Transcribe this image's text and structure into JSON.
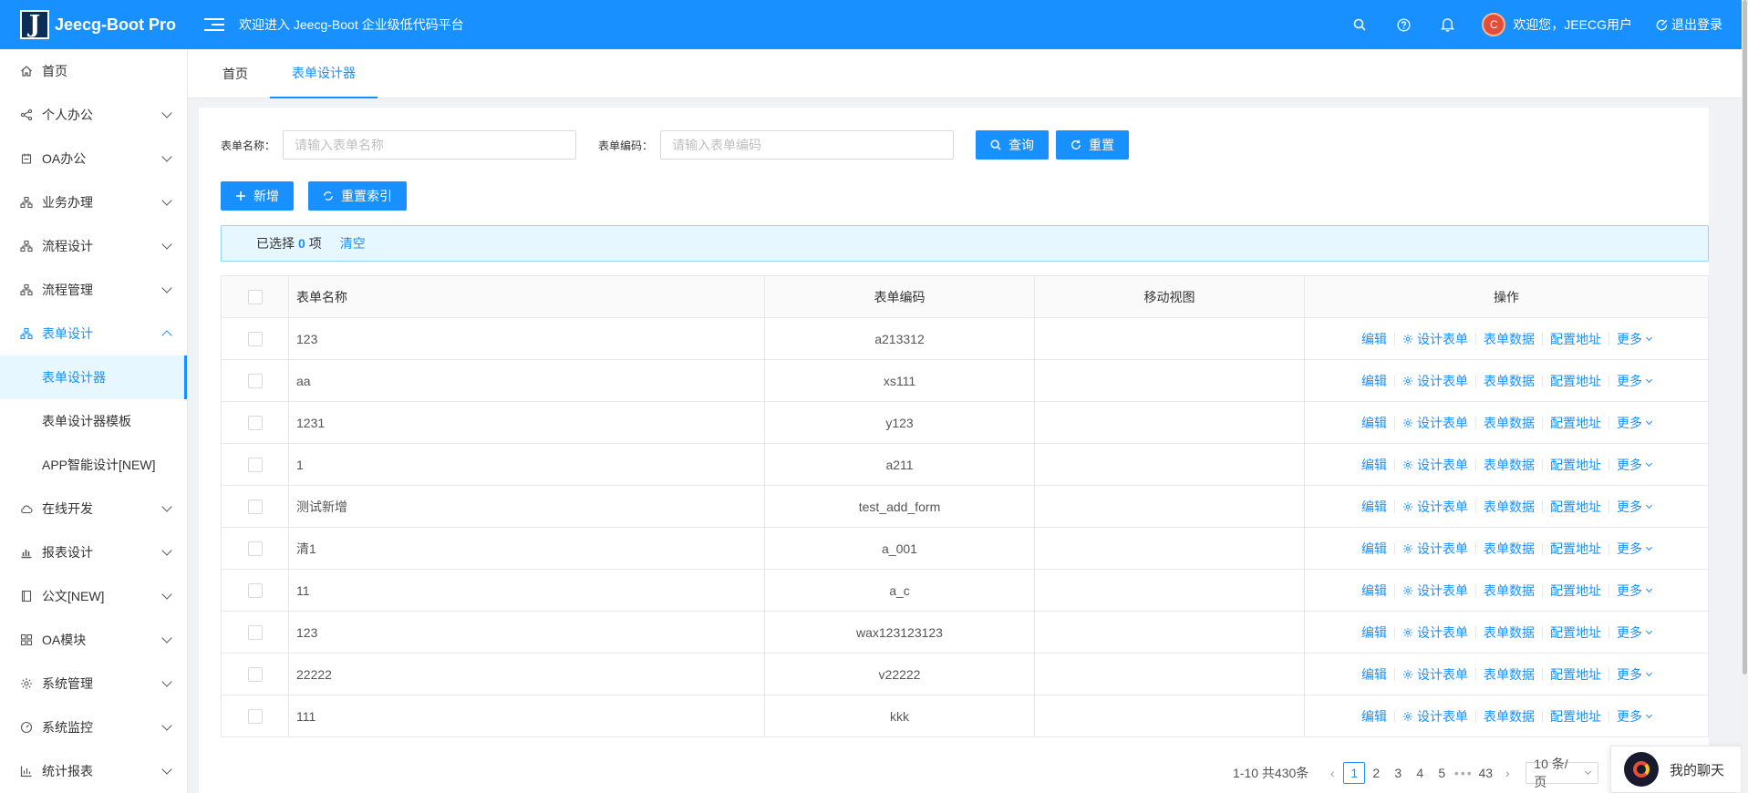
{
  "header": {
    "logo_letter": "J",
    "logo_text": "Jeecg-Boot Pro",
    "welcome": "欢迎进入 Jeecg-Boot 企业级低代码平台",
    "user_greeting": "欢迎您，JEECG用户",
    "logout": "退出登录",
    "avatar_text": "C",
    "icons": [
      "search-icon",
      "help-icon",
      "bell-icon"
    ]
  },
  "sidebar": {
    "items": [
      {
        "label": "首页",
        "icon": "home-icon"
      },
      {
        "label": "个人办公",
        "icon": "share-icon"
      },
      {
        "label": "OA办公",
        "icon": "bookmark-icon"
      },
      {
        "label": "业务办理",
        "icon": "cluster-icon"
      },
      {
        "label": "流程设计",
        "icon": "cluster-icon"
      },
      {
        "label": "流程管理",
        "icon": "cluster-icon"
      },
      {
        "label": "表单设计",
        "icon": "cluster-icon"
      },
      {
        "label": "在线开发",
        "icon": "cloud-icon"
      },
      {
        "label": "报表设计",
        "icon": "bar-chart-icon"
      },
      {
        "label": "公文[NEW]",
        "icon": "document-icon"
      },
      {
        "label": "OA模块",
        "icon": "grid-icon"
      },
      {
        "label": "系统管理",
        "icon": "gear-icon"
      },
      {
        "label": "系统监控",
        "icon": "dashboard-icon"
      },
      {
        "label": "统计报表",
        "icon": "chart-icon"
      }
    ],
    "sub_items": [
      {
        "label": "表单设计器"
      },
      {
        "label": "表单设计器模板"
      },
      {
        "label": "APP智能设计[NEW]"
      }
    ]
  },
  "tabs": [
    {
      "label": "首页"
    },
    {
      "label": "表单设计器"
    }
  ],
  "search": {
    "name_label": "表单名称：",
    "name_placeholder": "请输入表单名称",
    "code_label": "表单编码：",
    "code_placeholder": "请输入表单编码",
    "query": "查询",
    "reset": "重置"
  },
  "actions": {
    "add": "新增",
    "reset_index": "重置索引"
  },
  "selection": {
    "prefix": "已选择",
    "count": "0",
    "suffix": "项",
    "clear": "清空"
  },
  "table": {
    "headers": {
      "name": "表单名称",
      "code": "表单编码",
      "mobile": "移动视图",
      "ops": "操作"
    },
    "ops": {
      "edit": "编辑",
      "design": "设计表单",
      "data": "表单数据",
      "config": "配置地址",
      "more": "更多"
    },
    "rows": [
      {
        "name": "123",
        "code": "a213312"
      },
      {
        "name": "aa",
        "code": "xs111"
      },
      {
        "name": "1231",
        "code": "y123"
      },
      {
        "name": "1",
        "code": "a211"
      },
      {
        "name": "测试新增",
        "code": "test_add_form"
      },
      {
        "name": "清1",
        "code": "a_001"
      },
      {
        "name": "11",
        "code": "a_c"
      },
      {
        "name": "123",
        "code": "wax123123123"
      },
      {
        "name": "22222",
        "code": "v22222"
      },
      {
        "name": "111",
        "code": "kkk"
      }
    ]
  },
  "pagination": {
    "total": "1-10 共430条",
    "pages": [
      "1",
      "2",
      "3",
      "4",
      "5"
    ],
    "ellipsis": "•••",
    "last": "43",
    "page_size": "10 条/页"
  },
  "chat": {
    "label": "我的聊天"
  },
  "colors": {
    "primary": "#1890ff",
    "header_bg": "#1890ff",
    "alert_bg": "#e6f7ff"
  }
}
